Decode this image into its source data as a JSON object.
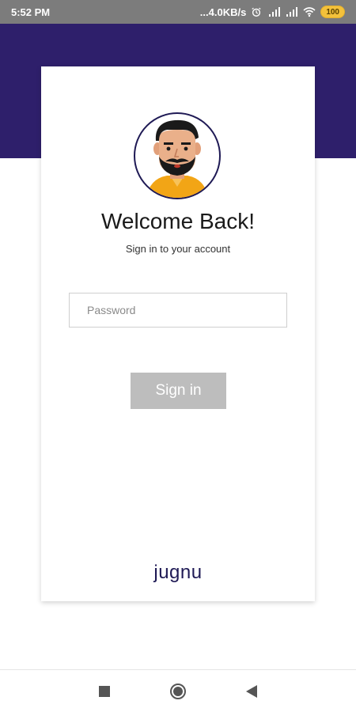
{
  "status_bar": {
    "time": "5:52 PM",
    "network_speed": "...4.0KB/s",
    "battery_level": "100",
    "icons": [
      "alarm-icon",
      "signal-icon",
      "signal-icon",
      "wifi-icon",
      "battery-icon"
    ]
  },
  "colors": {
    "header": "#2e1f6b",
    "status_bar": "#7c7c7c",
    "button_disabled": "#bdbdbd",
    "brand": "#1f1a55",
    "battery": "#f3c13b"
  },
  "login": {
    "title": "Welcome Back!",
    "subtitle": "Sign in to your account",
    "password_placeholder": "Password",
    "password_value": "",
    "signin_label": "Sign in",
    "brand": "jugnu"
  },
  "nav": {
    "items": [
      "recent-apps",
      "home",
      "back"
    ]
  }
}
